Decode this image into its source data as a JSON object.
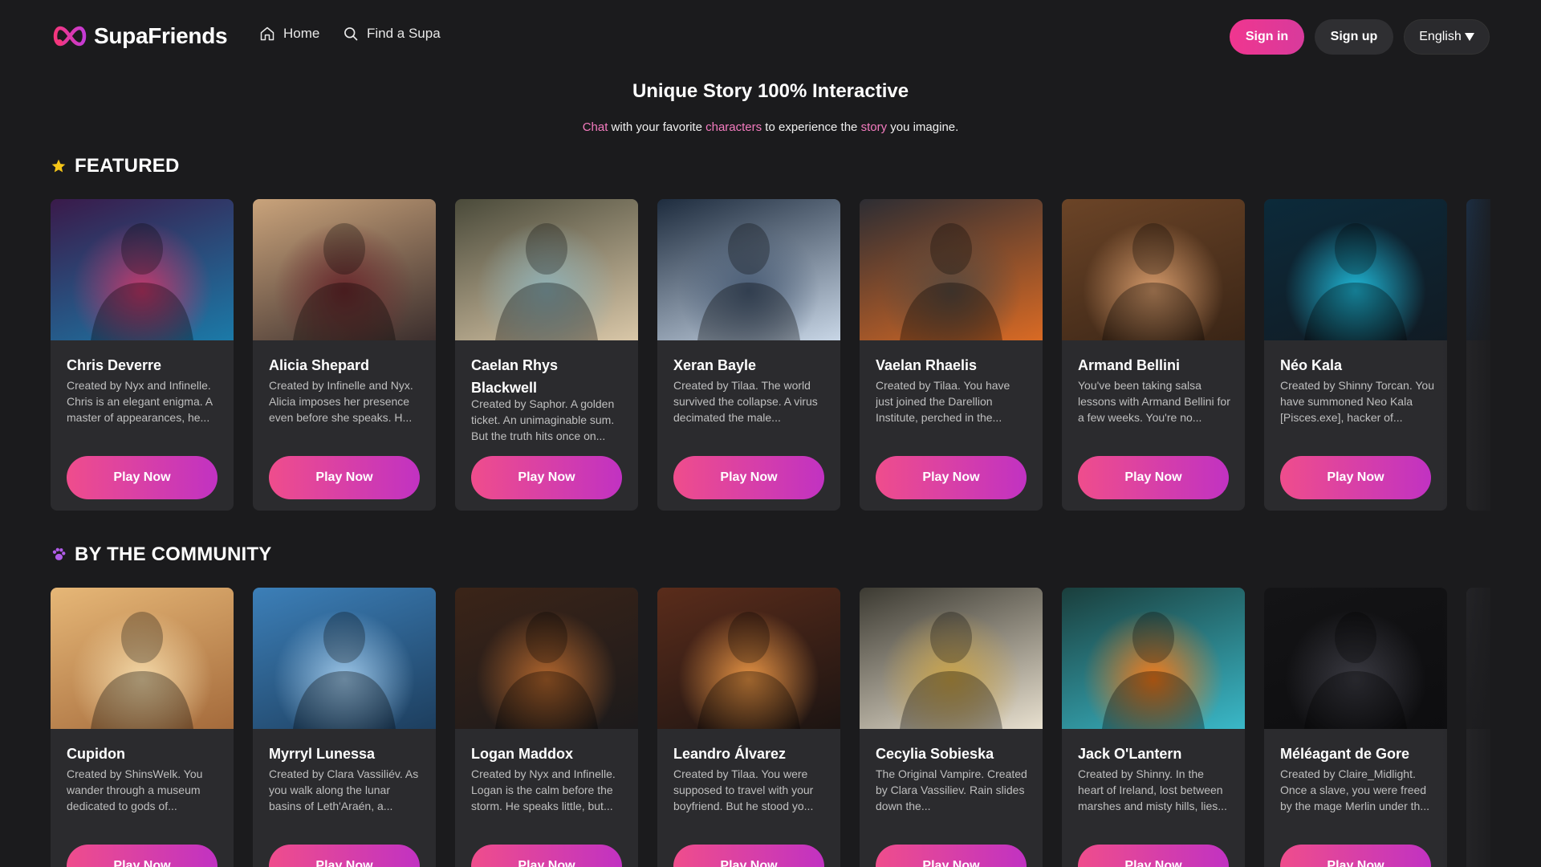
{
  "app": {
    "name": "SupaFriends"
  },
  "nav": {
    "home": "Home",
    "find": "Find a Supa",
    "sign_in": "Sign in",
    "sign_up": "Sign up",
    "language": "English"
  },
  "hero": {
    "title": "Unique Story 100% Interactive",
    "sub_1": "Chat",
    "sub_2": " with your favorite ",
    "sub_3": "characters",
    "sub_4": " to experience the ",
    "sub_5": "story",
    "sub_6": " you imagine."
  },
  "featured": {
    "title": "FEATURED",
    "cards": [
      {
        "name": "Chris Deverre",
        "desc": "Created by Nyx and Infinelle. Chris is an elegant enigma. A master of appearances, he...",
        "play": "Play Now",
        "colors": [
          "#3a1a4a",
          "#c2386b",
          "#1b7aa8"
        ]
      },
      {
        "name": "Alicia Shepard",
        "desc": "Created by Infinelle and Nyx. Alicia imposes her presence even before she speaks. H...",
        "play": "Play Now",
        "colors": [
          "#c9a37b",
          "#6b2a2e",
          "#3b2e2d"
        ]
      },
      {
        "name": "Caelan Rhys Blackwell",
        "desc": "Created by Saphor. A golden ticket. An unimaginable sum. But the truth hits once on...",
        "play": "Play Now",
        "colors": [
          "#4a4a3a",
          "#8fb0b5",
          "#d9c7a8"
        ]
      },
      {
        "name": "Xeran Bayle",
        "desc": "Created by Tilaa. The world survived the collapse. A virus decimated the male...",
        "play": "Play Now",
        "colors": [
          "#1e2c3e",
          "#4a5d76",
          "#c8d6e6"
        ]
      },
      {
        "name": "Vaelan Rhaelis",
        "desc": "Created by Tilaa. You have just joined the Darellion Institute, perched in the...",
        "play": "Play Now",
        "colors": [
          "#2d2d33",
          "#5a4a3e",
          "#d96a24"
        ]
      },
      {
        "name": "Armand Bellini",
        "desc": "You've been taking salsa lessons with Armand Bellini for a few weeks. You're no...",
        "play": "Play Now",
        "colors": [
          "#6b4427",
          "#d59a6a",
          "#3a2516"
        ]
      },
      {
        "name": "Néo Kala",
        "desc": "Created by Shinny Torcan. You have summoned Neo Kala [Pisces.exe], hacker of...",
        "play": "Play Now",
        "colors": [
          "#0c2a3a",
          "#1fb8d8",
          "#111b24"
        ]
      },
      {
        "name": "",
        "desc": "",
        "play": "",
        "colors": [
          "#1c3c5e",
          "#2a5a80",
          "#1b1b1d"
        ]
      }
    ]
  },
  "community": {
    "title": "BY THE COMMUNITY",
    "cards": [
      {
        "name": "Cupidon",
        "desc": "Created by ShinsWelk. You wander through a museum dedicated to gods of...",
        "play": "Play Now",
        "colors": [
          "#e6b777",
          "#f4d9a8",
          "#a46a3b"
        ]
      },
      {
        "name": "Myrryl Lunessa",
        "desc": "Created by Clara Vassiliév. As you walk along the lunar basins of Leth'Araén, a...",
        "play": "Play Now",
        "colors": [
          "#3c7fb8",
          "#9cc6e8",
          "#1d3e5e"
        ]
      },
      {
        "name": "Logan Maddox",
        "desc": "Created by Nyx and Infinelle. Logan is the calm before the storm. He speaks little, but...",
        "play": "Play Now",
        "colors": [
          "#3b2418",
          "#b2662d",
          "#1c1a1b"
        ]
      },
      {
        "name": "Leandro Álvarez",
        "desc": "Created by Tilaa. You were supposed to travel with your boyfriend. But he stood yo...",
        "play": "Play Now",
        "colors": [
          "#5a2c1b",
          "#e89444",
          "#1c1412"
        ]
      },
      {
        "name": "Cecylia Sobieska",
        "desc": "The Original Vampire. Created by Clara Vassiliev. Rain slides down the...",
        "play": "Play Now",
        "colors": [
          "#3c3a32",
          "#c9a34a",
          "#e8e0cf"
        ]
      },
      {
        "name": "Jack O'Lantern",
        "desc": "Created by Shinny. In the heart of Ireland, lost between marshes and misty hills, lies...",
        "play": "Play Now",
        "colors": [
          "#1a3e3c",
          "#f27a1a",
          "#3ab8c8"
        ]
      },
      {
        "name": "Méléagant de Gore",
        "desc": "Created by Claire_Midlight. Once a slave, you were freed by the mage Merlin under th...",
        "play": "Play Now",
        "colors": [
          "#141416",
          "#3a3a42",
          "#0d0d0f"
        ]
      },
      {
        "name": "",
        "desc": "",
        "play": "",
        "colors": [
          "#2a2a2e",
          "#3a3a3e",
          "#1b1b1d"
        ]
      }
    ]
  }
}
